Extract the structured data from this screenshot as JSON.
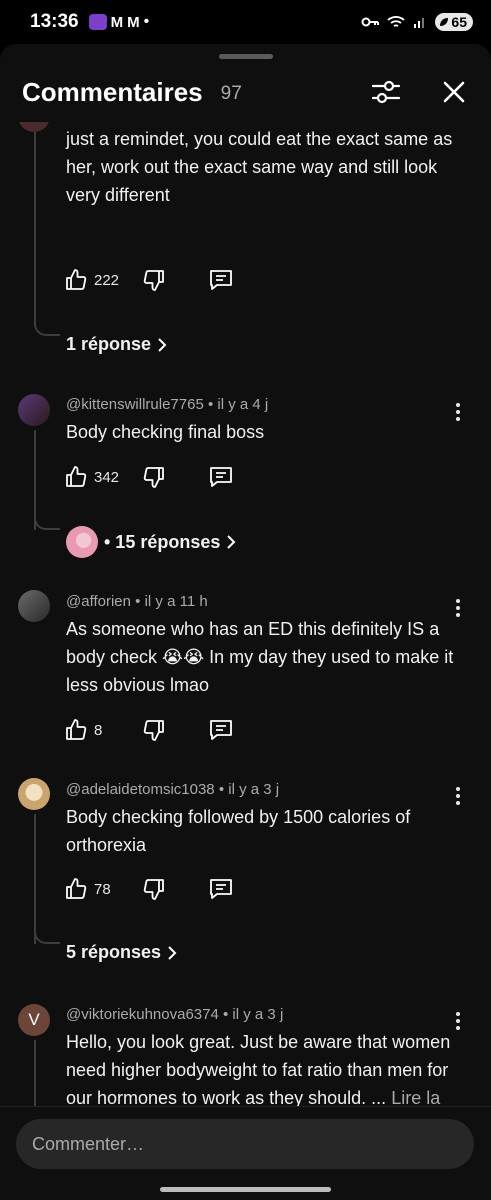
{
  "status_bar": {
    "time": "13:36",
    "battery": "65"
  },
  "header": {
    "title": "Commentaires",
    "count": "97"
  },
  "comments": [
    {
      "text": "just a remindet, you could eat the exact same as her, work out the exact same way and still look very different",
      "likes": "222",
      "replies_label": "1 réponse"
    },
    {
      "author": "@kittenswillrule7765",
      "time": "il y a 4 j",
      "text": "Body checking final boss",
      "likes": "342",
      "replies_label": "• 15 réponses"
    },
    {
      "author": "@afforien",
      "time": "il y a 11 h",
      "text": "As someone who has an ED this definitely IS a body check 😭😭 In my day they used to make it less obvious lmao",
      "likes": "8"
    },
    {
      "author": "@adelaidetomsic1038",
      "time": "il y a 3 j",
      "text": "Body checking followed by 1500 calories of orthorexia",
      "likes": "78",
      "replies_label": "5 réponses"
    },
    {
      "author": "@viktoriekuhnova6374",
      "time": "il y a 3 j",
      "avatar_letter": "V",
      "text": "Hello, you look great. Just be aware that women need higher bodyweight to fat ratio than men for our hormones to work as they should. ...",
      "more": "Lire la suite"
    }
  ],
  "composer": {
    "placeholder": "Commenter…"
  },
  "colors": {
    "background": "#0f0f0f",
    "text": "#f1f1f1",
    "secondary_text": "#aaaaaa",
    "thread_line": "#3d3d3d",
    "input_bg": "#272727"
  },
  "icons": [
    "filter-icon",
    "close-icon",
    "thumb-up-icon",
    "thumb-down-icon",
    "reply-icon",
    "more-vert-icon",
    "chevron-right-icon"
  ]
}
